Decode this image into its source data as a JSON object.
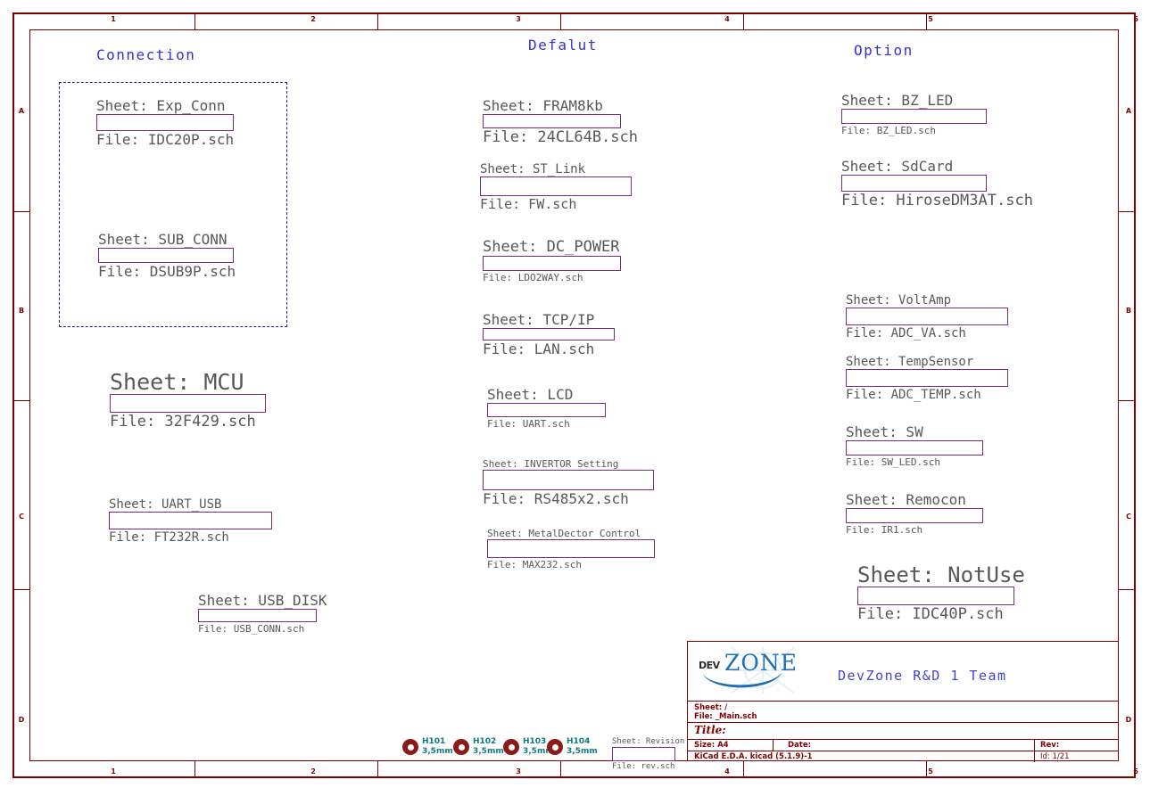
{
  "sheet": {
    "zone_columns": [
      "1",
      "2",
      "3",
      "4",
      "5",
      "6"
    ],
    "zone_rows": [
      "A",
      "B",
      "C",
      "D"
    ],
    "border_color": "#800000"
  },
  "groups": [
    {
      "name": "connection-group",
      "label": "Connection"
    },
    {
      "name": "default-group",
      "label": "Defalut"
    },
    {
      "name": "option-group",
      "label": "Option"
    }
  ],
  "sheets": [
    {
      "id": "exp-conn",
      "sheet": "Sheet: Exp_Conn",
      "file": "File: IDC20P.sch"
    },
    {
      "id": "sub-conn",
      "sheet": "Sheet: SUB_CONN",
      "file": "File: DSUB9P.sch"
    },
    {
      "id": "mcu",
      "sheet": "Sheet: MCU",
      "file": "File: 32F429.sch"
    },
    {
      "id": "uart-usb",
      "sheet": "Sheet: UART_USB",
      "file": "File: FT232R.sch"
    },
    {
      "id": "usb-disk",
      "sheet": "Sheet: USB_DISK",
      "file": "File: USB_CONN.sch"
    },
    {
      "id": "fram8kb",
      "sheet": "Sheet: FRAM8kb",
      "file": "File: 24CL64B.sch"
    },
    {
      "id": "st-link",
      "sheet": "Sheet: ST_Link",
      "file": "File: FW.sch"
    },
    {
      "id": "dc-power",
      "sheet": "Sheet: DC_POWER",
      "file": "File: LDO2WAY.sch"
    },
    {
      "id": "tcp-ip",
      "sheet": "Sheet: TCP/IP",
      "file": "File: LAN.sch"
    },
    {
      "id": "lcd",
      "sheet": "Sheet: LCD",
      "file": "File: UART.sch"
    },
    {
      "id": "invertor",
      "sheet": "Sheet: INVERTOR Setting",
      "file": "File: RS485x2.sch"
    },
    {
      "id": "metaldector",
      "sheet": "Sheet: MetalDector Control",
      "file": "File: MAX232.sch"
    },
    {
      "id": "bz-led",
      "sheet": "Sheet: BZ_LED",
      "file": "File: BZ_LED.sch"
    },
    {
      "id": "sdcard",
      "sheet": "Sheet: SdCard",
      "file": "File: HiroseDM3AT.sch"
    },
    {
      "id": "voltamp",
      "sheet": "Sheet: VoltAmp",
      "file": "File: ADC_VA.sch"
    },
    {
      "id": "tempsensor",
      "sheet": "Sheet: TempSensor",
      "file": "File: ADC_TEMP.sch"
    },
    {
      "id": "sw",
      "sheet": "Sheet: SW",
      "file": "File: SW_LED.sch"
    },
    {
      "id": "remocon",
      "sheet": "Sheet: Remocon",
      "file": "File: IR1.sch"
    },
    {
      "id": "notuse",
      "sheet": "Sheet: NotUse",
      "file": "File: IDC40P.sch"
    },
    {
      "id": "revision",
      "sheet": "Sheet: Revision",
      "file": "File: rev.sch"
    }
  ],
  "mounting_holes": [
    {
      "ref": "H101",
      "size": "3,5mm"
    },
    {
      "ref": "H102",
      "size": "3,5mm"
    },
    {
      "ref": "H103",
      "size": "3,5mm"
    },
    {
      "ref": "H104",
      "size": "3,5mm"
    }
  ],
  "title_block": {
    "logo_dev": "DEV",
    "logo_zone": "ZONE",
    "company": "DevZone R&D 1 Team",
    "sheet_path": "Sheet: /",
    "file_name": "File: _Main.sch",
    "title_label": "Title:",
    "size": "Size: A4",
    "date": "Date:",
    "rev": "Rev:",
    "eda": "KiCad E.D.A.  kicad (5.1.9)-1",
    "id": "Id: 1/21"
  }
}
